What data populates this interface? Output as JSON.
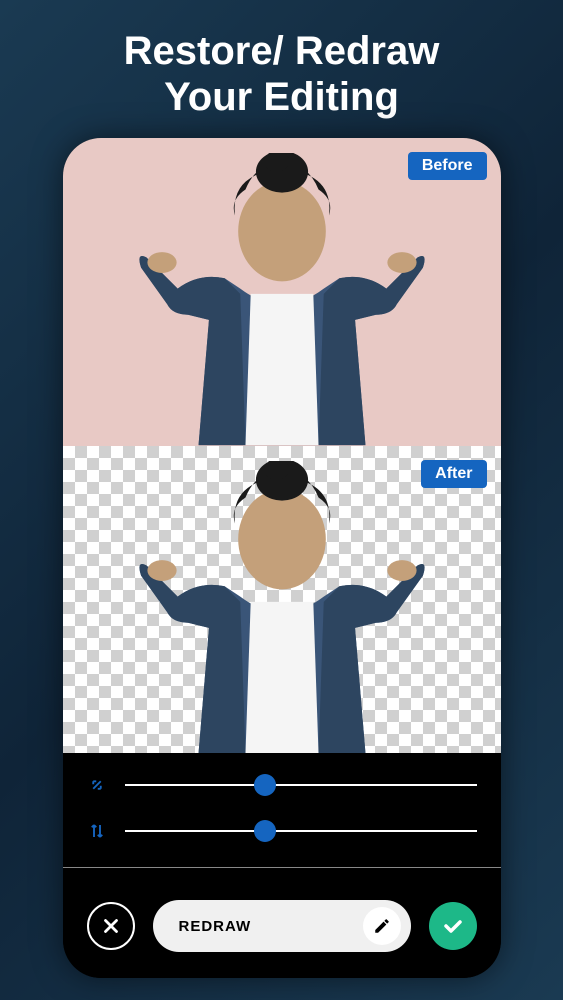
{
  "headline": {
    "line1": "Restore/ Redraw",
    "line2": "Your Editing"
  },
  "comparison": {
    "before_label": "Before",
    "after_label": "After"
  },
  "sliders": {
    "size": {
      "position": 40
    },
    "offset": {
      "position": 40
    }
  },
  "actions": {
    "mode_label": "REDRAW",
    "cancel_icon": "close-icon",
    "confirm_icon": "check-icon",
    "edit_icon": "pencil-icon"
  },
  "colors": {
    "accent": "#1565c0",
    "success": "#1db888",
    "background": "#1a3a52"
  }
}
